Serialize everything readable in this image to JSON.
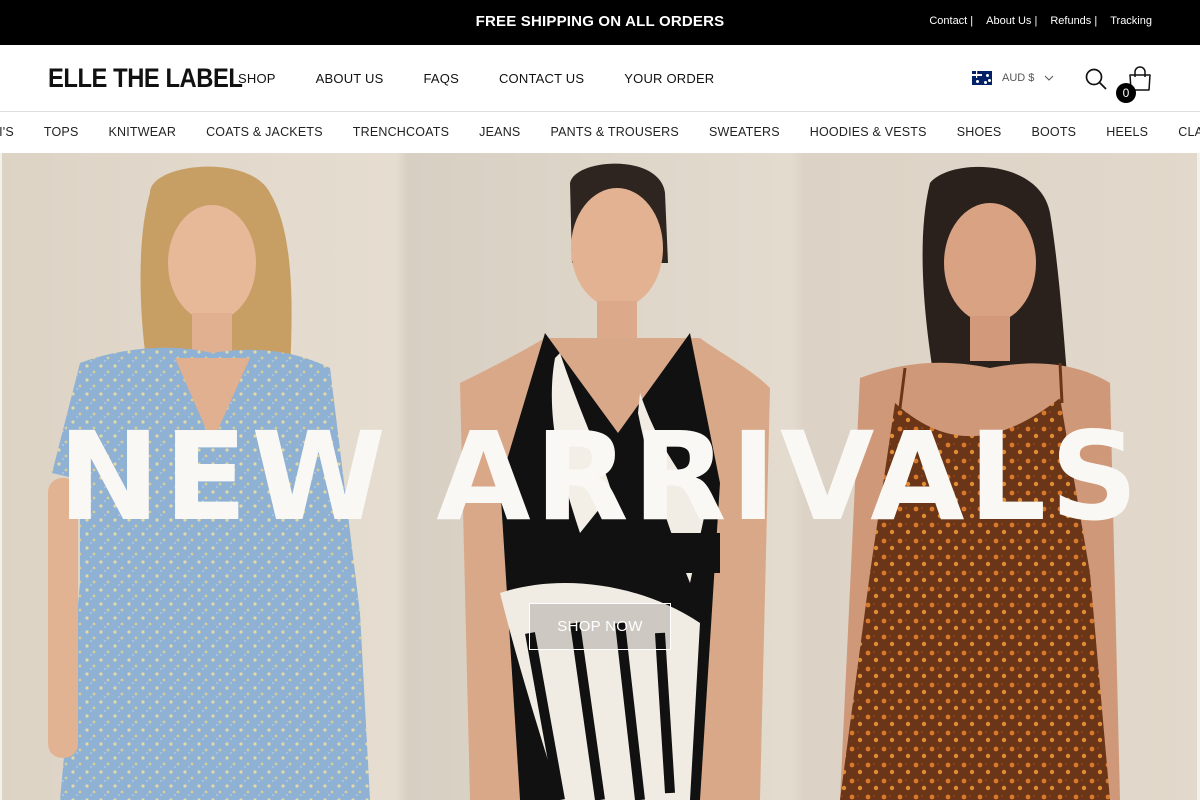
{
  "announcement": {
    "message": "FREE SHIPPING ON ALL ORDERS",
    "links": [
      "Contact |",
      "About Us |",
      "Refunds |",
      "Tracking"
    ]
  },
  "header": {
    "logo": "ELLE THE LABEL",
    "nav": [
      "SHOP",
      "ABOUT US",
      "FAQS",
      "CONTACT US",
      "YOUR ORDER"
    ],
    "currency": "AUD $",
    "cart_count": "0",
    "icons": {
      "search": "search-icon",
      "cart": "shopping-bag-icon",
      "flag": "australia-flag-icon",
      "dropdown": "chevron-down-icon"
    }
  },
  "categories": [
    "AXI'S",
    "TOPS",
    "KNITWEAR",
    "COATS & JACKETS",
    "TRENCHCOATS",
    "JEANS",
    "PANTS & TROUSERS",
    "SWEATERS",
    "HOODIES & VESTS",
    "SHOES",
    "BOOTS",
    "HEELS",
    "CLASSIC E"
  ],
  "hero": {
    "title": "NEW ARRIVALS",
    "cta": "SHOP NOW"
  },
  "colors": {
    "announcement_bg": "#000000",
    "hero_text": "#faf8f5",
    "cart_badge": "#000000"
  }
}
